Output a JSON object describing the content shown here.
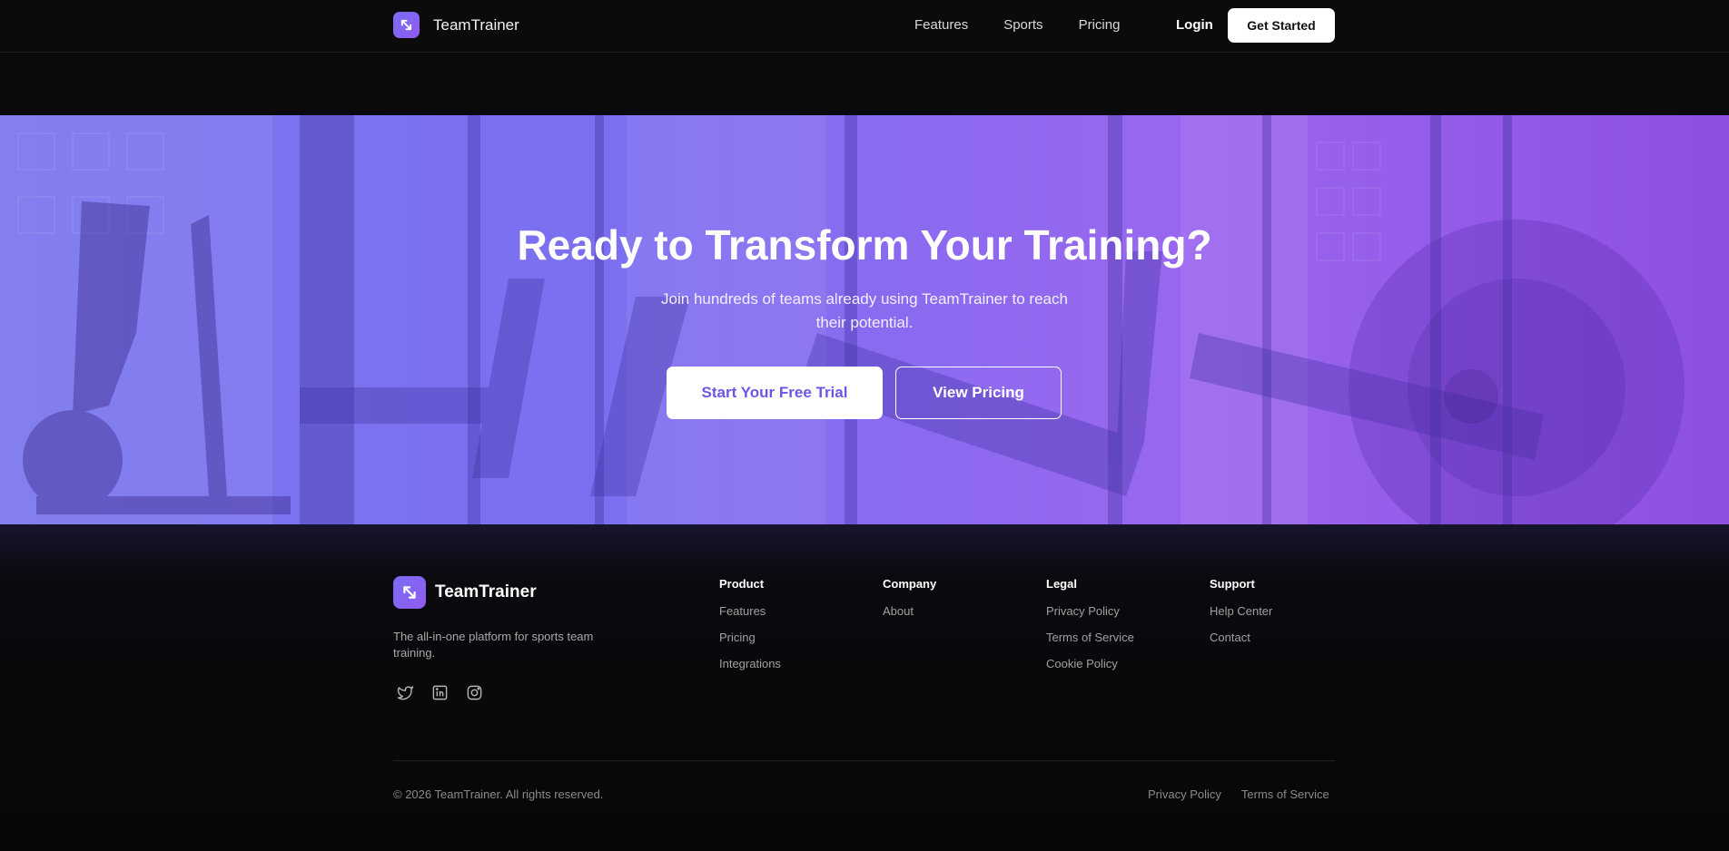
{
  "header": {
    "brand": "TeamTrainer",
    "nav": [
      "Features",
      "Sports",
      "Pricing"
    ],
    "login": "Login",
    "cta": "Get Started"
  },
  "hero": {
    "title": "Ready to Transform Your Training?",
    "subtitle": "Join hundreds of teams already using TeamTrainer to reach their potential.",
    "primary_cta": "Start Your Free Trial",
    "secondary_cta": "View Pricing",
    "accent_color": "#6a57e8"
  },
  "footer": {
    "brand": "TeamTrainer",
    "description": "The all-in-one platform for sports team training.",
    "socials": [
      "twitter-icon",
      "linkedin-icon",
      "instagram-icon"
    ],
    "columns": [
      {
        "title": "Product",
        "links": [
          "Features",
          "Pricing",
          "Integrations"
        ]
      },
      {
        "title": "Company",
        "links": [
          "About"
        ]
      },
      {
        "title": "Legal",
        "links": [
          "Privacy Policy",
          "Terms of Service",
          "Cookie Policy"
        ]
      },
      {
        "title": "Support",
        "links": [
          "Help Center",
          "Contact"
        ]
      }
    ],
    "copyright": "© 2026 TeamTrainer. All rights reserved.",
    "bottom_links": [
      "Privacy Policy",
      "Terms of Service"
    ]
  }
}
